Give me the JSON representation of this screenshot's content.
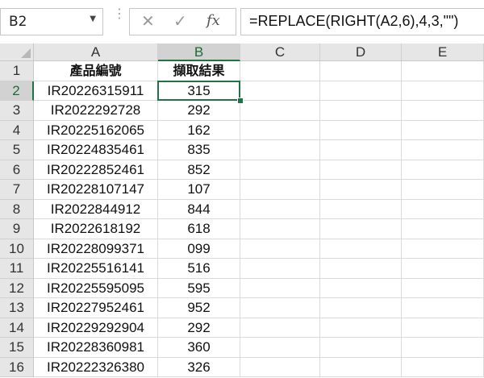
{
  "formula_bar": {
    "name_box": "B2",
    "formula": "=REPLACE(RIGHT(A2,6),4,3,\"\")",
    "cancel_icon": "✕",
    "enter_icon": "✓",
    "fx_label": "fx"
  },
  "columns": [
    "A",
    "B",
    "C",
    "D",
    "E"
  ],
  "rows": [
    "1",
    "2",
    "3",
    "4",
    "5",
    "6",
    "7",
    "8",
    "9",
    "10",
    "11",
    "12",
    "13",
    "14",
    "15",
    "16"
  ],
  "headers": {
    "a": "產品編號",
    "b": "擷取結果"
  },
  "data": [
    {
      "a": "IR20226315911",
      "b": "315"
    },
    {
      "a": "IR2022292728",
      "b": "292"
    },
    {
      "a": "IR20225162065",
      "b": "162"
    },
    {
      "a": "IR20224835461",
      "b": "835"
    },
    {
      "a": "IR20222852461",
      "b": "852"
    },
    {
      "a": "IR20228107147",
      "b": "107"
    },
    {
      "a": "IR2022844912",
      "b": "844"
    },
    {
      "a": "IR2022618192",
      "b": "618"
    },
    {
      "a": "IR20228099371",
      "b": "099"
    },
    {
      "a": "IR20225516141",
      "b": "516"
    },
    {
      "a": "IR20225595095",
      "b": "595"
    },
    {
      "a": "IR20227952461",
      "b": "952"
    },
    {
      "a": "IR20229292904",
      "b": "292"
    },
    {
      "a": "IR20228360981",
      "b": "360"
    },
    {
      "a": "IR20222326380",
      "b": "326"
    }
  ],
  "selected_cell": "B2",
  "colors": {
    "accent": "#217346",
    "header_bg": "#e6e6e6",
    "gridline": "#dadada"
  }
}
